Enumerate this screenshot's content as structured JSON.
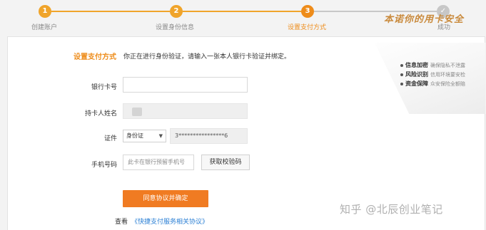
{
  "steps": [
    {
      "number": "1",
      "label": "创建账户",
      "state": "done"
    },
    {
      "number": "2",
      "label": "设置身份信息",
      "state": "done"
    },
    {
      "number": "3",
      "label": "设置支付方式",
      "state": "active"
    },
    {
      "number": "✓",
      "label": "成功",
      "state": "todo"
    }
  ],
  "header": {
    "title": "设置支付方式",
    "description": "你正在进行身份验证，请输入一张本人银行卡验证并绑定。"
  },
  "promise": {
    "title": "本诺你的用卡安全",
    "items": [
      {
        "bold": "信息加密",
        "note": "确保隐私不泄露"
      },
      {
        "bold": "风险识别",
        "note": "信用环境要安检"
      },
      {
        "bold": "资金保障",
        "note": "众安保险全额赔"
      }
    ]
  },
  "form": {
    "card_number_label": "银行卡号",
    "card_number_value": "",
    "holder_label": "持卡人姓名",
    "id_label": "证件",
    "id_type": "身份证",
    "id_number": "3****************6",
    "phone_label": "手机号码",
    "phone_placeholder": "此卡在银行预留手机号",
    "get_code_label": "获取校验码",
    "agree_button_label": "同意协议并确定",
    "agreement_prefix": "查看",
    "agreement_link": "《快捷支付服务相关协议》"
  },
  "watermark": "知乎 @北辰创业笔记",
  "colors": {
    "accent": "#ee8c1a",
    "button": "#f07b22",
    "link": "#2a7fd4"
  }
}
